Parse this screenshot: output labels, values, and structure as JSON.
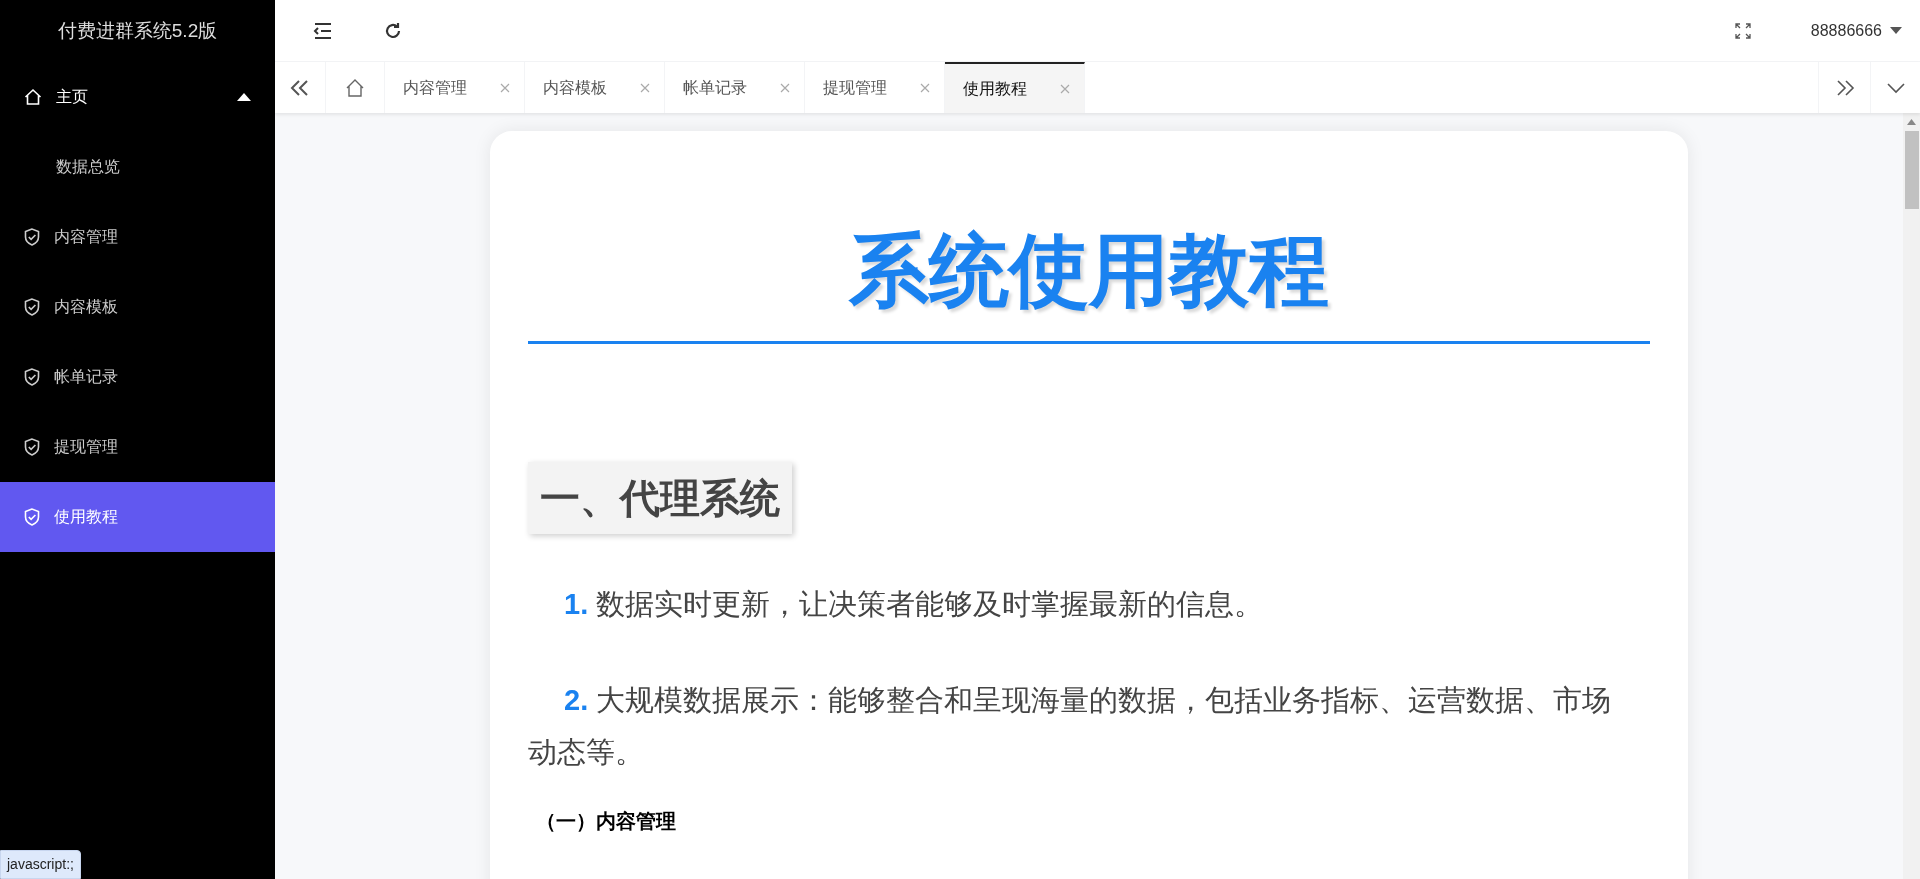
{
  "sidebar": {
    "title": "付费进群系统5.2版",
    "items": [
      {
        "label": "主页",
        "kind": "home",
        "expanded": true,
        "selected": false,
        "children": [
          {
            "label": "数据总览",
            "selected": false
          }
        ]
      },
      {
        "label": "内容管理",
        "kind": "page",
        "selected": false
      },
      {
        "label": "内容模板",
        "kind": "page",
        "selected": false
      },
      {
        "label": "帐单记录",
        "kind": "page",
        "selected": false
      },
      {
        "label": "提现管理",
        "kind": "page",
        "selected": false
      },
      {
        "label": "使用教程",
        "kind": "page",
        "selected": true
      }
    ]
  },
  "topbar": {
    "user": "88886666"
  },
  "tabs": [
    {
      "label": "内容管理",
      "selected": false
    },
    {
      "label": "内容模板",
      "selected": false
    },
    {
      "label": "帐单记录",
      "selected": false
    },
    {
      "label": "提现管理",
      "selected": false
    },
    {
      "label": "使用教程",
      "selected": true
    }
  ],
  "article": {
    "title": "系统使用教程",
    "blocks": [
      {
        "kind": "h2",
        "text": "一、代理系统"
      },
      {
        "kind": "p",
        "num": "1.",
        "text": "数据实时更新，让决策者能够及时掌握最新的信息。"
      },
      {
        "kind": "p",
        "num": "2.",
        "text": "大规模数据展示：能够整合和呈现海量的数据，包括业务指标、运营数据、市场动态等。"
      },
      {
        "kind": "h3",
        "text": "（一）内容管理"
      }
    ]
  },
  "status_bar": "javascript:;"
}
